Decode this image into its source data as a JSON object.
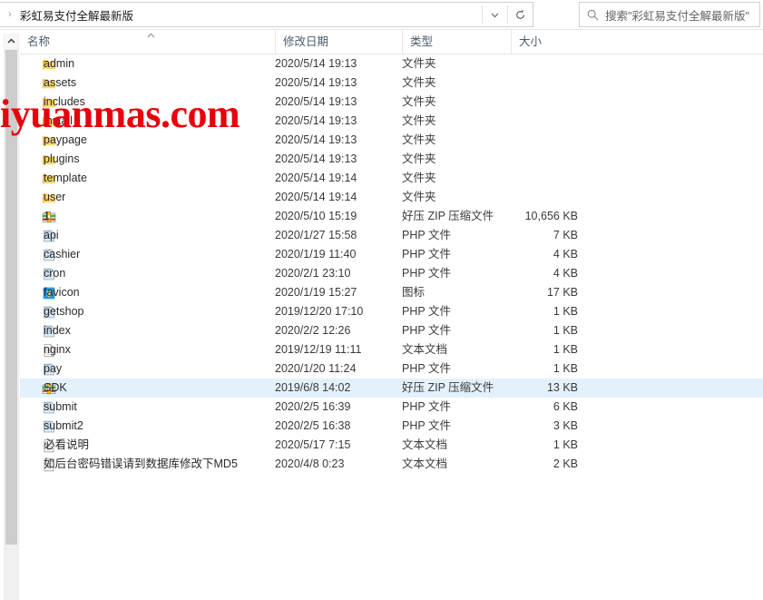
{
  "window": {
    "address": {
      "crumb_arrow": "›",
      "path_label": "彩虹易支付全解最新版",
      "dropdown_icon": "chevron-down-icon",
      "refresh_icon": "refresh-icon"
    },
    "search": {
      "icon": "search-icon",
      "placeholder": "搜索\"彩虹易支付全解最新版\""
    }
  },
  "watermark": {
    "text": "iyuanmas.com",
    "color": "#e8000b"
  },
  "columns": {
    "name": "名称",
    "date": "修改日期",
    "type": "类型",
    "size": "大小",
    "sort_caret": "^"
  },
  "selection": {
    "highlight_color": "#e3f1fb",
    "selected_name": "SDK"
  },
  "files": [
    {
      "name": "admin",
      "date": "2020/5/14 19:13",
      "type": "文件夹",
      "size": "",
      "icon": "folder-icon",
      "selected": false
    },
    {
      "name": "assets",
      "date": "2020/5/14 19:13",
      "type": "文件夹",
      "size": "",
      "icon": "folder-icon",
      "selected": false
    },
    {
      "name": "includes",
      "date": "2020/5/14 19:13",
      "type": "文件夹",
      "size": "",
      "icon": "folder-icon",
      "selected": false
    },
    {
      "name": "install",
      "date": "2020/5/14 19:13",
      "type": "文件夹",
      "size": "",
      "icon": "folder-icon",
      "selected": false
    },
    {
      "name": "paypage",
      "date": "2020/5/14 19:13",
      "type": "文件夹",
      "size": "",
      "icon": "folder-icon",
      "selected": false
    },
    {
      "name": "plugins",
      "date": "2020/5/14 19:13",
      "type": "文件夹",
      "size": "",
      "icon": "folder-icon",
      "selected": false
    },
    {
      "name": "template",
      "date": "2020/5/14 19:14",
      "type": "文件夹",
      "size": "",
      "icon": "folder-icon",
      "selected": false
    },
    {
      "name": "user",
      "date": "2020/5/14 19:14",
      "type": "文件夹",
      "size": "",
      "icon": "folder-icon",
      "selected": false
    },
    {
      "name": "1",
      "date": "2020/5/10 15:19",
      "type": "好压 ZIP 压缩文件",
      "size": "10,656 KB",
      "icon": "zip-icon",
      "selected": false
    },
    {
      "name": "api",
      "date": "2020/1/27 15:58",
      "type": "PHP 文件",
      "size": "7 KB",
      "icon": "php-icon",
      "selected": false
    },
    {
      "name": "cashier",
      "date": "2020/1/19 11:40",
      "type": "PHP 文件",
      "size": "4 KB",
      "icon": "php-icon",
      "selected": false
    },
    {
      "name": "cron",
      "date": "2020/2/1 23:10",
      "type": "PHP 文件",
      "size": "4 KB",
      "icon": "php-icon",
      "selected": false
    },
    {
      "name": "favicon",
      "date": "2020/1/19 15:27",
      "type": "图标",
      "size": "17 KB",
      "icon": "favicon-icon",
      "selected": false
    },
    {
      "name": "getshop",
      "date": "2019/12/20 17:10",
      "type": "PHP 文件",
      "size": "1 KB",
      "icon": "php-icon",
      "selected": false
    },
    {
      "name": "index",
      "date": "2020/2/2 12:26",
      "type": "PHP 文件",
      "size": "1 KB",
      "icon": "php-icon",
      "selected": false
    },
    {
      "name": "nginx",
      "date": "2019/12/19 11:11",
      "type": "文本文档",
      "size": "1 KB",
      "icon": "text-icon",
      "selected": false
    },
    {
      "name": "pay",
      "date": "2020/1/20 11:24",
      "type": "PHP 文件",
      "size": "1 KB",
      "icon": "php-icon",
      "selected": false
    },
    {
      "name": "SDK",
      "date": "2019/6/8 14:02",
      "type": "好压 ZIP 压缩文件",
      "size": "13 KB",
      "icon": "zip-icon",
      "selected": true
    },
    {
      "name": "submit",
      "date": "2020/2/5 16:39",
      "type": "PHP 文件",
      "size": "6 KB",
      "icon": "php-icon",
      "selected": false
    },
    {
      "name": "submit2",
      "date": "2020/2/5 16:38",
      "type": "PHP 文件",
      "size": "3 KB",
      "icon": "php-icon",
      "selected": false
    },
    {
      "name": "必看说明",
      "date": "2020/5/17 7:15",
      "type": "文本文档",
      "size": "1 KB",
      "icon": "text-icon",
      "selected": false
    },
    {
      "name": "如后台密码错误请到数据库修改下MD5",
      "date": "2020/4/8 0:23",
      "type": "文本文档",
      "size": "2 KB",
      "icon": "text-icon",
      "selected": false
    }
  ]
}
